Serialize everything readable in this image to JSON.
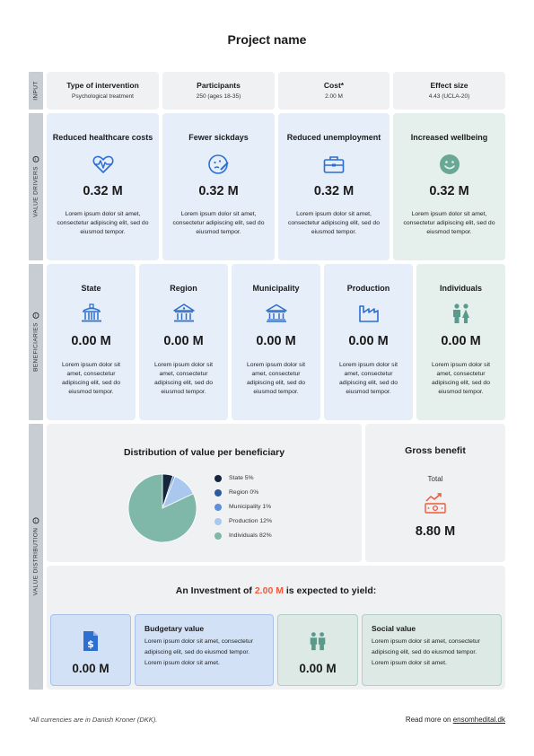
{
  "title": "Project name",
  "side_labels": {
    "input": "INPUT",
    "value_drivers": "VALUE DRIVERS",
    "beneficiaries": "BENEFICIARIES",
    "value_distribution": "VALUE DISTRIBUTION",
    "info_glyph": "i"
  },
  "inputs": [
    {
      "label": "Type of intervention",
      "value": "Psychological treatment"
    },
    {
      "label": "Participants",
      "value": "250 (ages 18-35)"
    },
    {
      "label": "Cost*",
      "value": "2.00 M"
    },
    {
      "label": "Effect size",
      "value": "4.43 (UCLA-20)"
    }
  ],
  "value_drivers": [
    {
      "title": "Reduced healthcare costs",
      "icon": "heart-pulse-icon",
      "value": "0.32 M",
      "text": "Lorem ipsum dolor sit amet, consectetur adipiscing elit, sed do eiusmod tempor."
    },
    {
      "title": "Fewer sickdays",
      "icon": "sick-face-icon",
      "value": "0.32 M",
      "text": "Lorem ipsum dolor sit amet, consectetur adipiscing elit, sed do eiusmod tempor."
    },
    {
      "title": "Reduced unemployment",
      "icon": "briefcase-icon",
      "value": "0.32 M",
      "text": "Lorem ipsum dolor sit amet, consectetur adipiscing elit, sed do eiusmod tempor."
    },
    {
      "title": "Increased wellbeing",
      "icon": "smiley-icon",
      "value": "0.32 M",
      "text": "Lorem ipsum dolor sit amet, consectetur adipiscing elit, sed do eiusmod tempor."
    }
  ],
  "beneficiaries": [
    {
      "title": "State",
      "icon": "capitol-icon",
      "value": "0.00 M",
      "text": "Lorem ipsum dolor sit amet, consectetur adipiscing elit, sed do eiusmod tempor."
    },
    {
      "title": "Region",
      "icon": "building-icon",
      "value": "0.00 M",
      "text": "Lorem ipsum dolor sit amet, consectetur adipiscing elit, sed do eiusmod tempor."
    },
    {
      "title": "Municipality",
      "icon": "bank-icon",
      "value": "0.00 M",
      "text": "Lorem ipsum dolor sit amet, consectetur adipiscing elit, sed do eiusmod tempor."
    },
    {
      "title": "Production",
      "icon": "factory-icon",
      "value": "0.00 M",
      "text": "Lorem ipsum dolor sit amet, consectetur adipiscing elit, sed do eiusmod tempor."
    },
    {
      "title": "Individuals",
      "icon": "people-icon",
      "value": "0.00 M",
      "text": "Lorem ipsum dolor sit amet, consectetur adipiscing elit, sed do eiusmod tempor."
    }
  ],
  "chart_data": {
    "type": "pie",
    "title": "Distribution of value per beneficiary",
    "categories": [
      "State",
      "Region",
      "Municipality",
      "Production",
      "Individuals"
    ],
    "values": [
      5,
      0,
      1,
      12,
      82
    ],
    "legend_labels": [
      "State 5%",
      "Region 0%",
      "Municipality 1%",
      "Production 12%",
      "Individuals 82%"
    ],
    "colors": [
      "#14253d",
      "#2c5aa0",
      "#5e8fd8",
      "#aac8ee",
      "#7fb8a8"
    ],
    "legend_position": "right"
  },
  "gross_benefit": {
    "title": "Gross benefit",
    "subtitle": "Total",
    "icon": "money-growth-icon",
    "value": "8.80 M"
  },
  "investment": {
    "prefix": "An Investment of ",
    "amount": "2.00 M",
    "suffix": " is expected to yield:",
    "highlight_color": "#ee5a3a"
  },
  "yield": {
    "budgetary": {
      "icon": "dollar-document-icon",
      "value": "0.00 M",
      "title": "Budgetary value",
      "text": "Lorem ipsum dolor sit amet, consectetur adipiscing elit, sed do eiusmod tempor. Lorem ipsum dolor sit amet."
    },
    "social": {
      "icon": "people-icon",
      "value": "0.00 M",
      "title": "Social value",
      "text": "Lorem ipsum dolor sit amet, consectetur adipiscing elit, sed do eiusmod tempor. Lorem ipsum dolor sit amet."
    }
  },
  "footer": {
    "note": "*All currencies are in Danish Kroner (DKK).",
    "read_more": "Read more on ",
    "link": "ensomhedital.dk"
  },
  "colors": {
    "accent_blue": "#2c6fd1",
    "accent_green": "#5a9a8a",
    "accent_orange": "#ee5a3a"
  }
}
